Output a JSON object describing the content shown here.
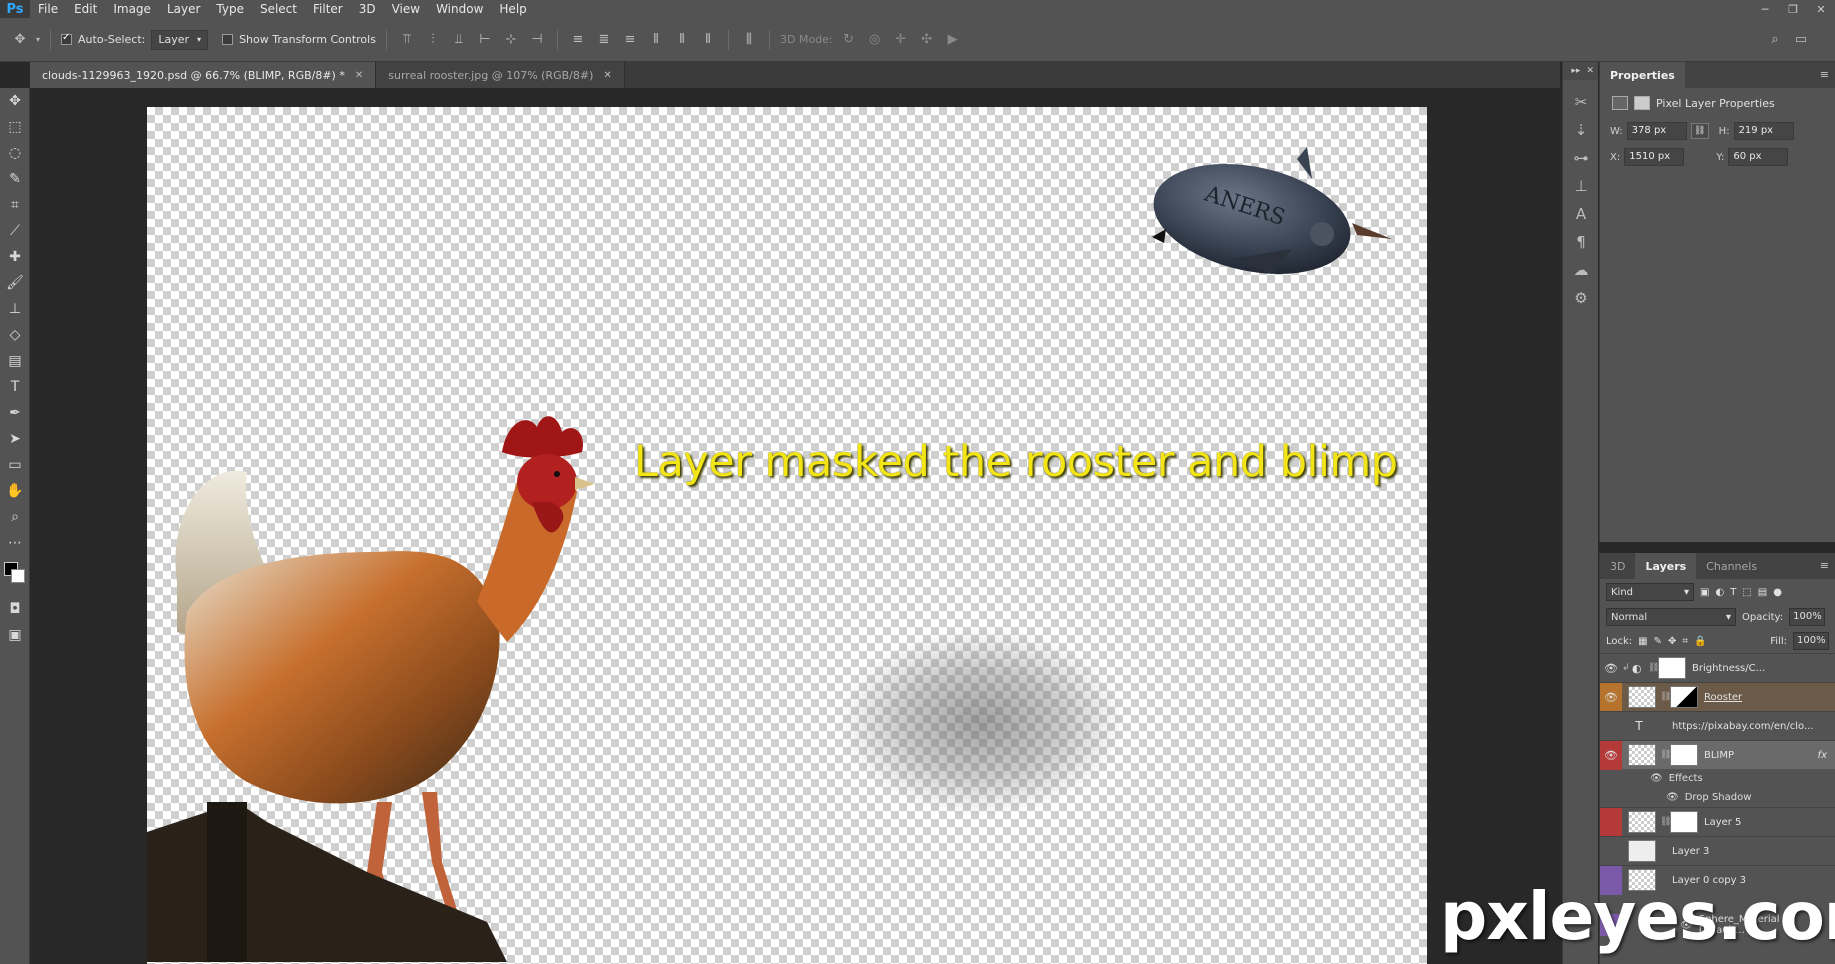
{
  "app": {
    "logo": "Ps"
  },
  "menu": [
    "File",
    "Edit",
    "Image",
    "Layer",
    "Type",
    "Select",
    "Filter",
    "3D",
    "View",
    "Window",
    "Help"
  ],
  "window_controls": [
    "─",
    "❐",
    "✕"
  ],
  "options": {
    "auto_select_label": "Auto-Select:",
    "auto_select_target": "Layer",
    "show_transform_label": "Show Transform Controls",
    "mode_3d_label": "3D Mode:"
  },
  "tabs": [
    {
      "label": "clouds-1129963_1920.psd @ 66.7% (BLIMP, RGB/8#) *",
      "active": true
    },
    {
      "label": "surreal rooster.jpg @ 107% (RGB/8#)",
      "active": false
    }
  ],
  "canvas": {
    "text": "Layer masked the rooster and blimp"
  },
  "properties": {
    "tab": "Properties",
    "subtitle": "Pixel Layer Properties",
    "w_label": "W:",
    "w": "378 px",
    "h_label": "H:",
    "h": "219 px",
    "x_label": "X:",
    "x": "1510 px",
    "y_label": "Y:",
    "y": "60 px"
  },
  "layers_panel": {
    "tabs": [
      "3D",
      "Layers",
      "Channels"
    ],
    "kind": "Kind",
    "blend_mode": "Normal",
    "opacity_label": "Opacity:",
    "opacity": "100%",
    "lock_label": "Lock:",
    "fill_label": "Fill:",
    "fill": "100%",
    "layers": [
      {
        "name": "Brightness/C...",
        "visible": true,
        "color": ""
      },
      {
        "name": "Rooster",
        "visible": true,
        "color": "#b5732d"
      },
      {
        "name": "https://pixabay.com/en/clo...",
        "visible": false,
        "color": "",
        "type": "text"
      },
      {
        "name": "BLIMP",
        "visible": true,
        "color": "#b43a3a",
        "fx": "fx"
      },
      {
        "name": "Layer 5",
        "visible": false,
        "color": "#b43a3a"
      },
      {
        "name": "Layer 3",
        "visible": false,
        "color": ""
      },
      {
        "name": "Layer 0 copy 3",
        "visible": false,
        "color": "#7a5aa8"
      }
    ],
    "effects_label": "Effects",
    "drop_shadow_label": "Drop Shadow",
    "sphere_label": "Sphere_Material - Default..."
  },
  "watermark": "pxleyes.com"
}
